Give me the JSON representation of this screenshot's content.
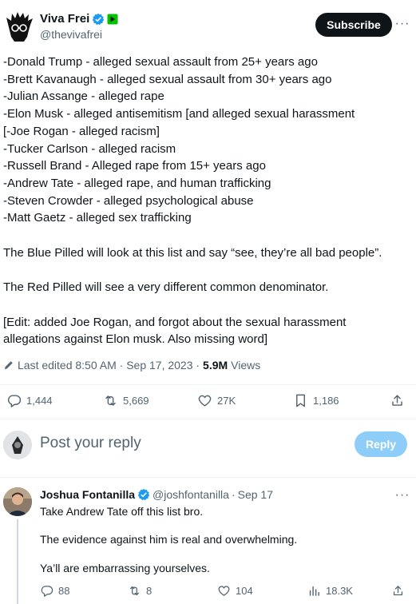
{
  "tweet": {
    "author": {
      "name": "Viva Frei",
      "handle": "@thevivafrei"
    },
    "subscribe_label": "Subscribe",
    "more_label": "···",
    "body_lines": [
      "-Donald Trump - alleged sexual assault from 25+ years ago",
      "-Brett Kavanaugh - alleged sexual assault from 30+ years ago",
      "-Julian Assange - alleged rape",
      "-Elon Musk - alleged antisemitism [and alleged sexual harassment",
      "[-Joe Rogan - alleged racism]",
      "-Tucker Carlson - alleged racism",
      "-Russell Brand - Alleged rape from 15+ years ago",
      "-Andrew Tate - alleged rape, and human trafficking",
      "-Steven Crowder - alleged psychological abuse",
      "-Matt Gaetz - alleged sex trafficking"
    ],
    "para_1": "The Blue Pilled will look at this list and say “see, they’re all bad people”.",
    "para_2": "The Red Pilled will see a very different common denominator.",
    "para_3_line_1": "[Edit: added Joe Rogan, and forgot about the sexual harassment",
    "para_3_line_2": "allegations against Elon musk. Also missing word]",
    "meta": {
      "edited_label": "Last edited 8:50 AM · Sep 17, 2023 ·",
      "views_count": "5.9M",
      "views_label": "Views"
    },
    "actions": {
      "replies": "1,444",
      "reposts": "5,669",
      "likes": "27K",
      "bookmarks": "1,186"
    }
  },
  "composer": {
    "placeholder": "Post your reply",
    "reply_label": "Reply"
  },
  "reply": {
    "name": "Joshua Fontanilla",
    "handle": "@joshfontanilla",
    "sep": "·",
    "date": "Sep 17",
    "more_label": "···",
    "lines": [
      "Take Andrew Tate off this list bro.",
      "The evidence against him is real and overwhelming.",
      "Ya’ll are embarrassing yourselves."
    ],
    "actions": {
      "replies": "88",
      "reposts": "8",
      "likes": "104",
      "views": "18.3K"
    }
  },
  "colors": {
    "verified": "#1d9bf0",
    "muted": "#536471",
    "reply_button": "#8ecdf8"
  }
}
